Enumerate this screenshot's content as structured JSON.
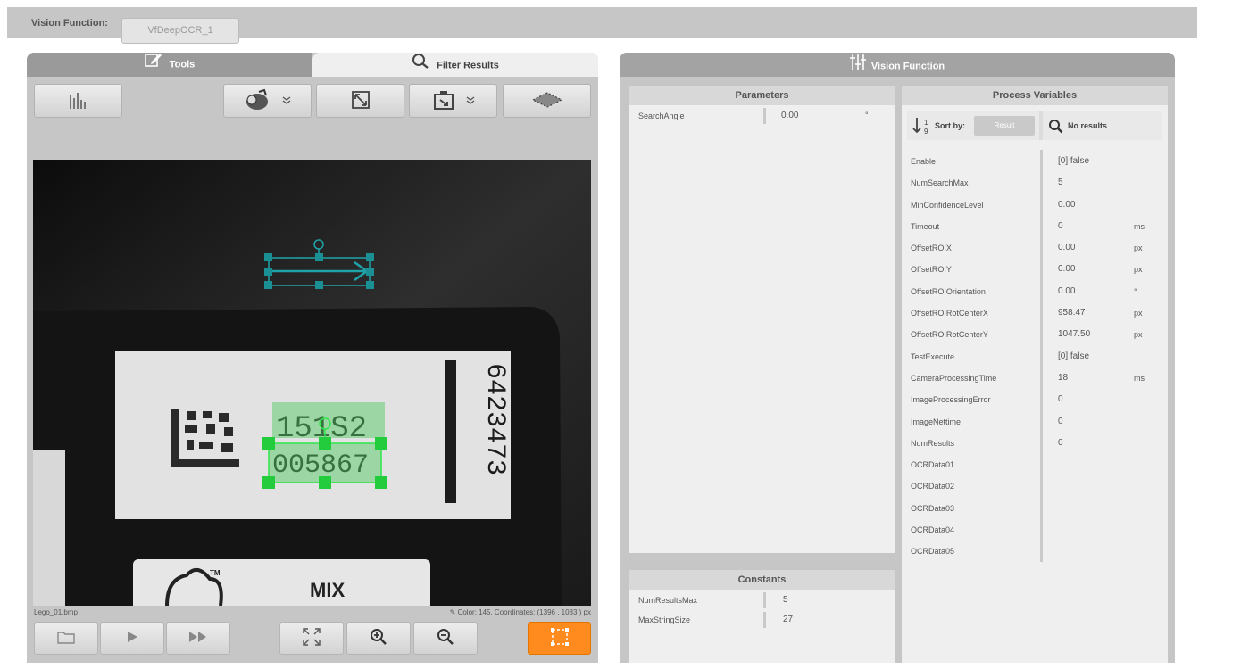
{
  "header": {
    "label": "Vision Function:",
    "value": "VfDeepOCR_1"
  },
  "left_tabs": {
    "tools": "Tools",
    "filter": "Filter Results"
  },
  "viewer": {
    "image_text": {
      "top_line": "151S2",
      "bottom_line": "005867",
      "side_number": "6423473",
      "box_label": "MIX",
      "trademark": "TM"
    },
    "file_name": "Lego_01.bmp",
    "info": "Color:  145, Coordinates: (1396 , 1083 ) px"
  },
  "right_title": "Vision Function",
  "parameters": {
    "title": "Parameters",
    "rows": [
      {
        "name": "SearchAngle",
        "value": "0.00",
        "unit": "°"
      }
    ]
  },
  "constants": {
    "title": "Constants",
    "rows": [
      {
        "name": "NumResultsMax",
        "value": "5"
      },
      {
        "name": "MaxStringSize",
        "value": "27"
      }
    ]
  },
  "process_variables": {
    "title": "Process Variables",
    "sort_label": "Sort by:",
    "sort_value": "Result",
    "search_label": "No results",
    "rows": [
      {
        "name": "Enable",
        "value": "[0] false",
        "unit": ""
      },
      {
        "name": "NumSearchMax",
        "value": "5",
        "unit": ""
      },
      {
        "name": "MinConfidenceLevel",
        "value": "0.00",
        "unit": ""
      },
      {
        "name": "Timeout",
        "value": "0",
        "unit": "ms"
      },
      {
        "name": "OffsetROIX",
        "value": "0.00",
        "unit": "px"
      },
      {
        "name": "OffsetROIY",
        "value": "0.00",
        "unit": "px"
      },
      {
        "name": "OffsetROIOrientation",
        "value": "0.00",
        "unit": "°"
      },
      {
        "name": "OffsetROIRotCenterX",
        "value": "958.47",
        "unit": "px"
      },
      {
        "name": "OffsetROIRotCenterY",
        "value": "1047.50",
        "unit": "px"
      },
      {
        "name": "TestExecute",
        "value": "[0] false",
        "unit": ""
      },
      {
        "name": "CameraProcessingTime",
        "value": "18",
        "unit": "ms"
      },
      {
        "name": "ImageProcessingError",
        "value": "0",
        "unit": ""
      },
      {
        "name": "ImageNettime",
        "value": "0",
        "unit": ""
      },
      {
        "name": "NumResults",
        "value": "0",
        "unit": ""
      },
      {
        "name": "OCRData01",
        "value": "",
        "unit": ""
      },
      {
        "name": "OCRData02",
        "value": "",
        "unit": ""
      },
      {
        "name": "OCRData03",
        "value": "",
        "unit": ""
      },
      {
        "name": "OCRData04",
        "value": "",
        "unit": ""
      },
      {
        "name": "OCRData05",
        "value": "",
        "unit": ""
      }
    ]
  },
  "colors": {
    "accent_orange": "#ff8a1d",
    "roi_teal": "#1fa3a8",
    "roi_green": "#2ee64a"
  }
}
